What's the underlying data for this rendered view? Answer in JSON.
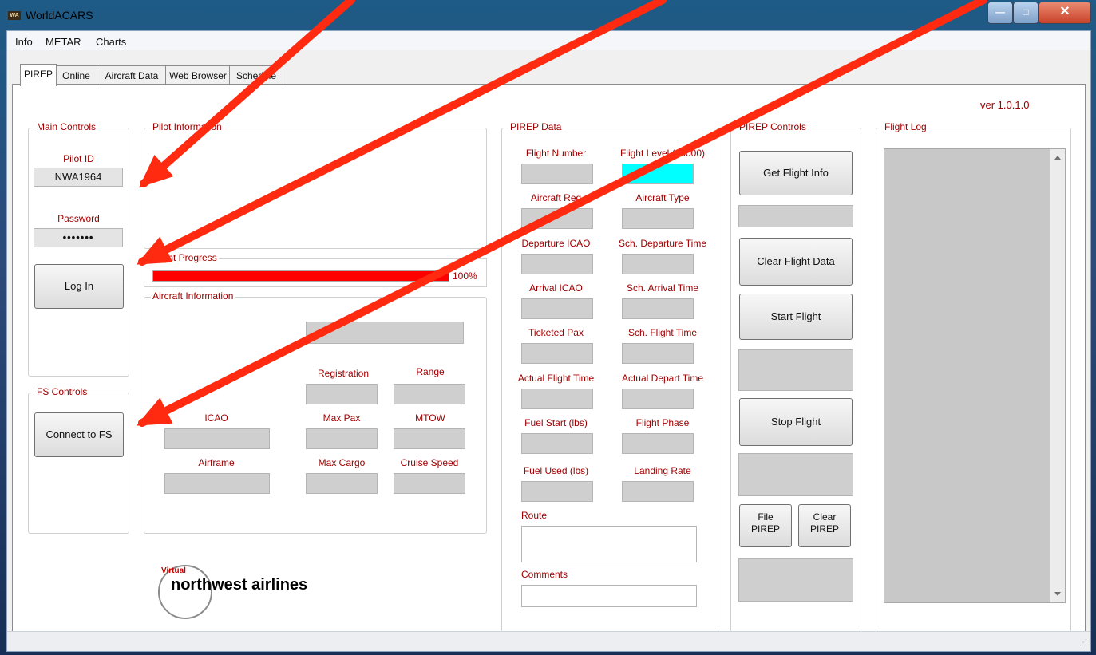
{
  "window": {
    "title": "WorldACARS",
    "icon": "app-icon",
    "icon_text": "WA"
  },
  "window_controls": {
    "minimize": "—",
    "maximize": "□",
    "close": "✕"
  },
  "menu": [
    "Info",
    "METAR",
    "Charts"
  ],
  "tabs": [
    "PIREP",
    "Online",
    "Aircraft Data",
    "Web Browser",
    "Schedule"
  ],
  "version": "ver 1.0.1.0",
  "main_controls": {
    "title": "Main Controls",
    "pilot_id_label": "Pilot ID",
    "pilot_id_value": "NWA1964",
    "password_label": "Password",
    "password_value": "•••••••",
    "login_button": "Log In"
  },
  "fs_controls": {
    "title": "FS Controls",
    "connect_button": "Connect to FS"
  },
  "pilot_info": {
    "title": "Pilot Information"
  },
  "flight_progress": {
    "title": "Flight Progress",
    "percent_text": "100%",
    "value": 1.0,
    "bar_color": "#ff0000"
  },
  "aircraft_info": {
    "title": "Aircraft Information",
    "registration": "Registration",
    "range": "Range",
    "icao": "ICAO",
    "max_pax": "Max Pax",
    "mtow": "MTOW",
    "airframe": "Airframe",
    "max_cargo": "Max Cargo",
    "cruise_speed": "Cruise Speed"
  },
  "pirep_data": {
    "title": "PIREP Data",
    "flight_number": "Flight Number",
    "flight_level": "Flight Level (30000)",
    "flight_level_color": "#00ffff",
    "aircraft_reg": "Aircraft Reg",
    "aircraft_type": "Aircraft Type",
    "departure_icao": "Departure ICAO",
    "sch_departure_time": "Sch. Departure Time",
    "arrival_icao": "Arrival ICAO",
    "sch_arrival_time": "Sch. Arrival Time",
    "ticketed_pax": "Ticketed Pax",
    "sch_flight_time": "Sch. Flight Time",
    "actual_flight_time": "Actual Flight Time",
    "actual_depart_time": "Actual Depart Time",
    "fuel_start": "Fuel Start (lbs)",
    "flight_phase": "Flight Phase",
    "fuel_used": "Fuel Used (lbs)",
    "landing_rate": "Landing Rate",
    "route": "Route",
    "comments": "Comments"
  },
  "pirep_controls": {
    "title": "PIREP Controls",
    "get_flight_info": "Get Flight Info",
    "clear_flight_data": "Clear Flight Data",
    "start_flight": "Start Flight",
    "stop_flight": "Stop Flight",
    "file_pirep_1": "File",
    "file_pirep_2": "PIREP",
    "clear_pirep_1": "Clear",
    "clear_pirep_2": "PIREP"
  },
  "flight_log": {
    "title": "Flight Log"
  },
  "logo": {
    "small": "Virtual",
    "text": "northwest airlines"
  },
  "annotation_color": "#ff2a10"
}
